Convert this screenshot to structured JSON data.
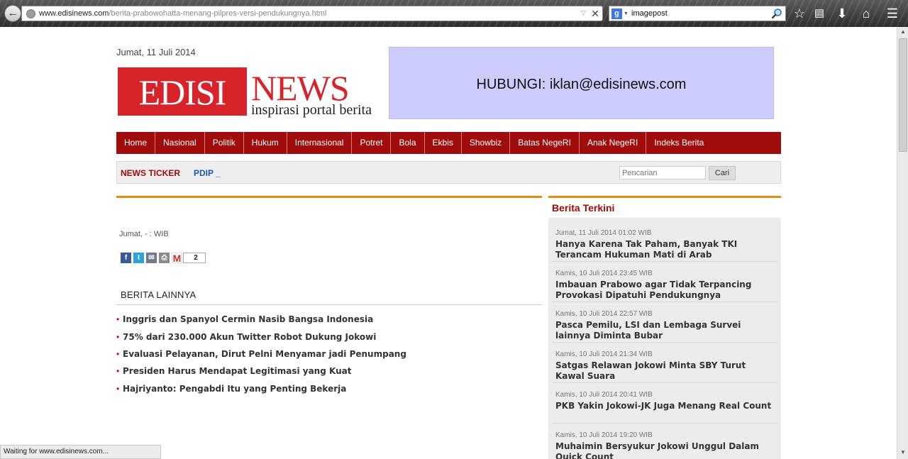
{
  "browser": {
    "url_domain": "www.edisinews.com",
    "url_path": "/berita-prabowohatta-menang-pilpres-versi-pendukungnya.html",
    "search_query": "imagepost",
    "search_engine_icon": "g",
    "status_text": "Waiting for www.edisinews.com..."
  },
  "header": {
    "date": "Jumat, 11 Juli 2014",
    "logo": {
      "edisi": "EDISI",
      "news": "NEWS",
      "tagline": "inspirasi portal berita"
    },
    "ad_text": "HUBUNGI: iklan@edisinews.com"
  },
  "nav": {
    "items": [
      "Home",
      "Nasional",
      "Politik",
      "Hukum",
      "Internasional",
      "Potret",
      "Bola",
      "Ekbis",
      "Showbiz",
      "Batas NegeRI",
      "Anak NegeRI",
      "Indeks Berita"
    ]
  },
  "ticker": {
    "label": "NEWS TICKER",
    "text": "PDIP _",
    "search_placeholder": "Pencarian",
    "search_button": "Cari"
  },
  "article": {
    "date": "Jumat, - : WIB",
    "share_count": "2"
  },
  "lainnya": {
    "title": "BERITA LAINNYA",
    "items": [
      "Inggris dan Spanyol Cermin Nasib Bangsa Indonesia",
      "75% dari 230.000 Akun Twitter Robot Dukung Jokowi",
      "Evaluasi Pelayanan, Dirut Pelni Menyamar jadi Penumpang",
      "Presiden Harus Mendapat Legitimasi yang Kuat",
      "Hajriyanto: Pengabdi Itu yang Penting Bekerja"
    ]
  },
  "terkini": {
    "title": "Berita Terkini",
    "items": [
      {
        "date": "Jumat, 11 Juli 2014 01:02 WIB",
        "headline": "Hanya Karena Tak Paham, Banyak TKI Terancam Hukuman Mati di Arab"
      },
      {
        "date": "Kamis, 10 Juli 2014 23:45 WIB",
        "headline": "Imbauan Prabowo agar Tidak Terpancing Provokasi Dipatuhi Pendukungnya"
      },
      {
        "date": "Kamis, 10 Juli 2014 22:57 WIB",
        "headline": "Pasca Pemilu, LSI dan Lembaga Survei lainnya Diminta Bubar"
      },
      {
        "date": "Kamis, 10 Juli 2014 21:34 WIB",
        "headline": "Satgas Relawan Jokowi Minta SBY Turut Kawal Suara"
      },
      {
        "date": "Kamis, 10 Juli 2014 20:41 WIB",
        "headline": "PKB Yakin Jokowi-JK Juga Menang Real Count"
      },
      {
        "date": "Kamis, 10 Juli 2014 19:20 WIB",
        "headline": "Muhaimin Bersyukur Jokowi Unggul Dalam Quick Count"
      }
    ]
  },
  "colors": {
    "brand_red": "#d9232b",
    "nav_red": "#a00b0b",
    "accent_orange": "#e88a13",
    "ticker_blue": "#1e5aa8"
  }
}
